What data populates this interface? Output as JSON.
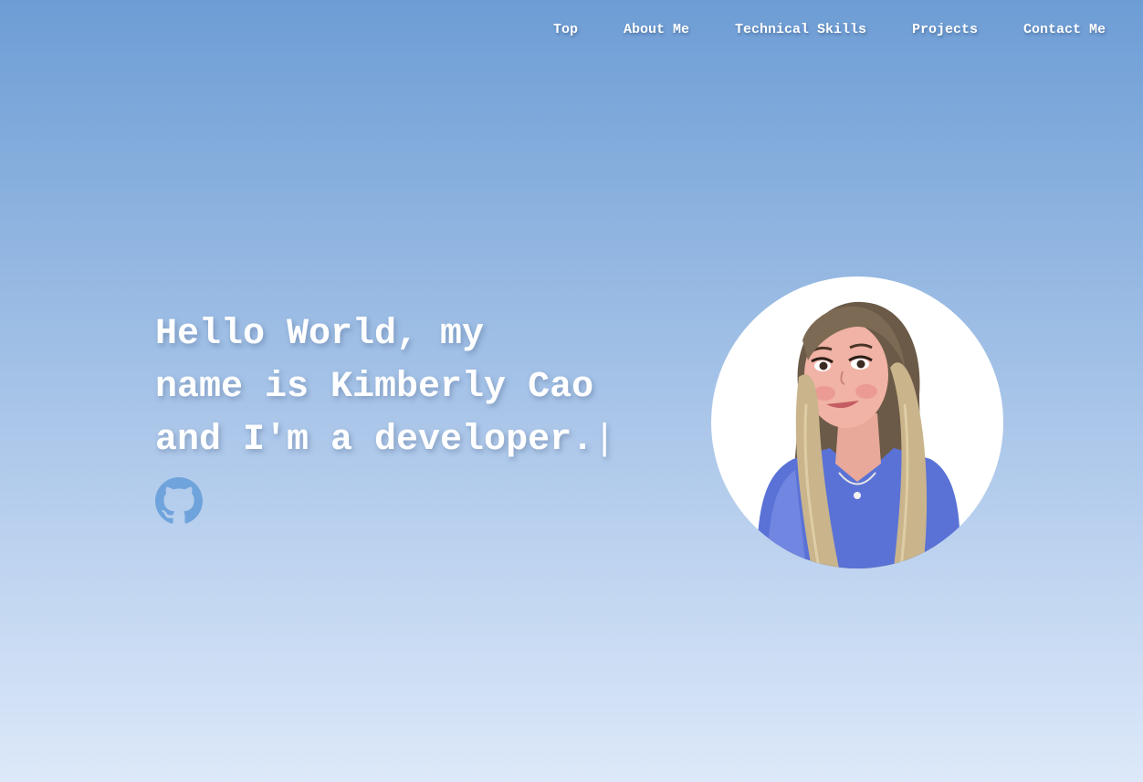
{
  "nav": {
    "items": [
      {
        "label": "Top"
      },
      {
        "label": "About Me"
      },
      {
        "label": "Technical Skills"
      },
      {
        "label": "Projects"
      },
      {
        "label": "Contact Me"
      }
    ]
  },
  "hero": {
    "headline": "Hello World, my\nname is Kimberly Cao\nand I'm a developer.",
    "cursor": "|",
    "github_icon": "github-icon",
    "avatar": "cartoon-portrait-avatar"
  },
  "colors": {
    "gradient_top": "#6d9dd5",
    "gradient_bottom": "#dde9f9",
    "icon_blue": "#6fa3dc",
    "text": "#ffffff"
  }
}
